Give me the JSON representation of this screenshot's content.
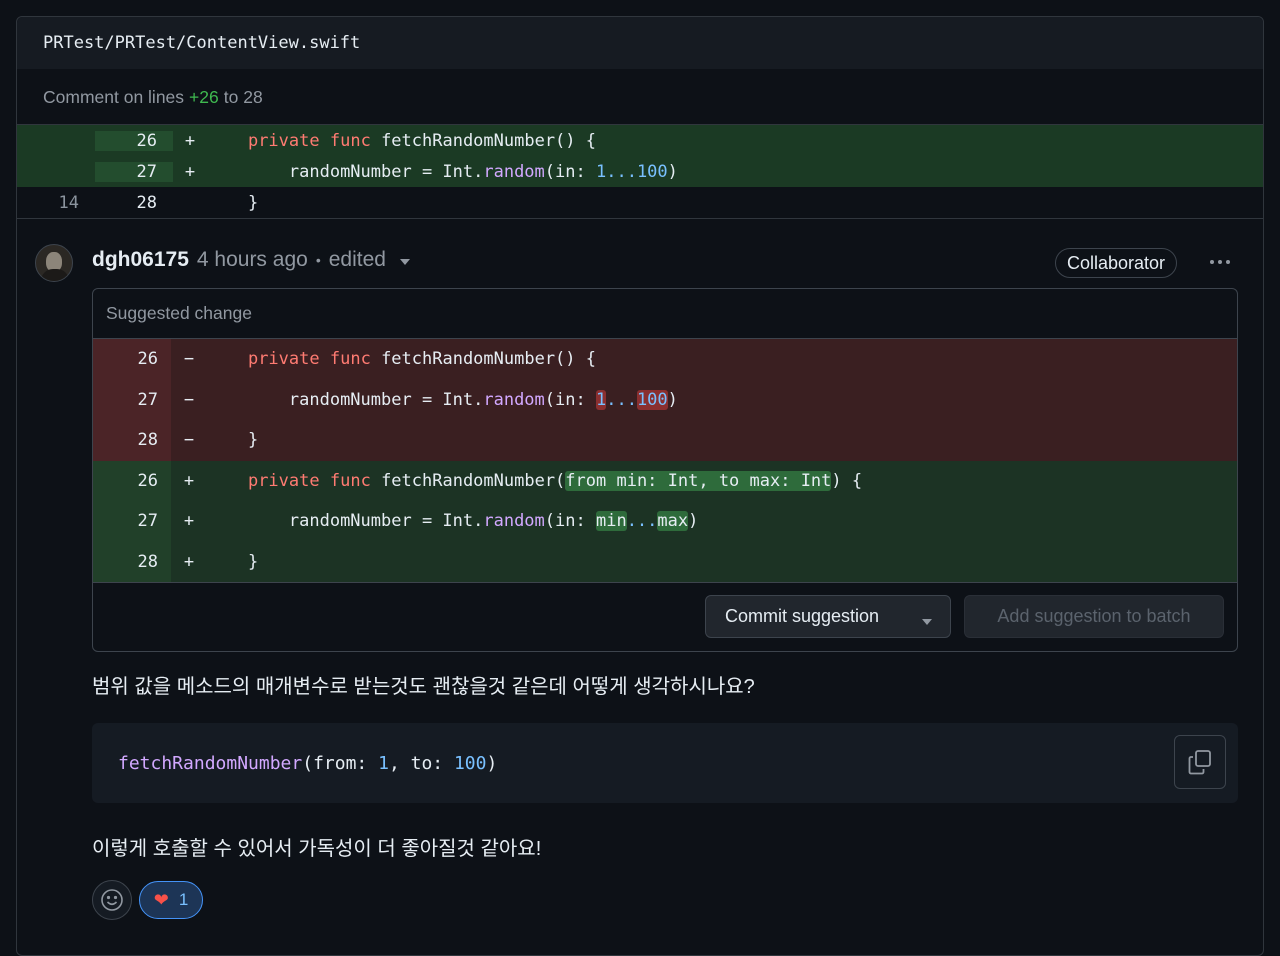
{
  "file": {
    "path": "PRTest/PRTest/ContentView.swift"
  },
  "comment_range": {
    "prefix": "Comment on lines",
    "start": "+26",
    "joiner": "to",
    "end": "28"
  },
  "context_lines": [
    {
      "old": "",
      "new": "26",
      "sign": "+",
      "type": "add"
    },
    {
      "old": "",
      "new": "27",
      "sign": "+",
      "type": "add"
    },
    {
      "old": "14",
      "new": "28",
      "sign": "",
      "type": "plain"
    }
  ],
  "comment": {
    "author": "dgh06175",
    "time": "4 hours ago",
    "separator": "•",
    "edited": "edited",
    "role_badge": "Collaborator",
    "suggested_title": "Suggested change",
    "commit_button": "Commit suggestion",
    "batch_button": "Add suggestion to batch",
    "body_line1": "범위 값을 메소드의 매개변수로 받는것도 괜찮을것 같은데 어떻게 생각하시나요?",
    "body_line2": "이렇게 호출할 수 있어서 가독성이 더 좋아질것 같아요!",
    "reaction_heart_count": "1"
  },
  "suggestion_lines": [
    {
      "ln": "26",
      "sign": "−",
      "type": "del"
    },
    {
      "ln": "27",
      "sign": "−",
      "type": "del"
    },
    {
      "ln": "28",
      "sign": "−",
      "type": "del"
    },
    {
      "ln": "26",
      "sign": "+",
      "type": "ins"
    },
    {
      "ln": "27",
      "sign": "+",
      "type": "ins"
    },
    {
      "ln": "28",
      "sign": "+",
      "type": "ins"
    }
  ],
  "code_tokens": {
    "private": "private",
    "func": "func",
    "fetch_sig": "fetchRandomNumber() {",
    "fetch_name": "fetchRandomNumber(",
    "params": "from min: Int, to max: Int",
    "sig_end": ") {",
    "assign": "randomNumber = Int.",
    "random": "random",
    "in": "(in: ",
    "one": "1",
    "dots": "...",
    "hundred": "100",
    "close_paren": ")",
    "min": "min",
    "max": "max",
    "brace": "}"
  },
  "code_block": {
    "fn": "fetchRandomNumber",
    "p1": "(from: ",
    "v1": "1",
    "p2": ", to: ",
    "v2": "100",
    "p3": ")"
  },
  "colors": {
    "accent_blue": "#4493f8",
    "add_bg": "#1b3a24",
    "del_bg": "#3a1f21",
    "keyword": "#ff7b72",
    "function": "#d2a8ff",
    "number": "#79c0ff"
  },
  "icons": [
    "kebab-icon",
    "caret-down-icon",
    "copy-icon",
    "smiley-icon",
    "heart-icon"
  ]
}
